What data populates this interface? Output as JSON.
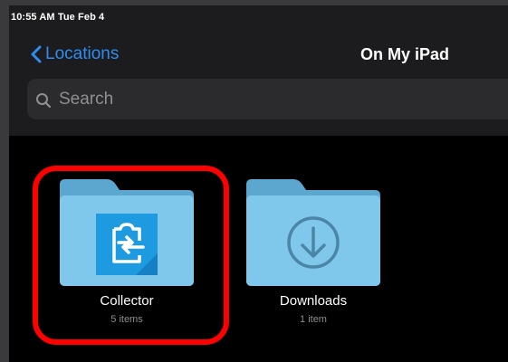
{
  "status_bar": {
    "time_date": "10:55 AM  Tue Feb 4"
  },
  "nav": {
    "back_label": "Locations",
    "title": "On My iPad"
  },
  "search": {
    "placeholder": "Search",
    "value": ""
  },
  "folders": [
    {
      "name": "Collector",
      "count": "5 items",
      "icon": "collector-app-icon"
    },
    {
      "name": "Downloads",
      "count": "1 item",
      "icon": "download-arrow-icon"
    }
  ],
  "colors": {
    "accent": "#2f8cf1",
    "folder_front": "#7fc8ec",
    "folder_back": "#5ba7cf",
    "highlight": "#ff0000"
  }
}
